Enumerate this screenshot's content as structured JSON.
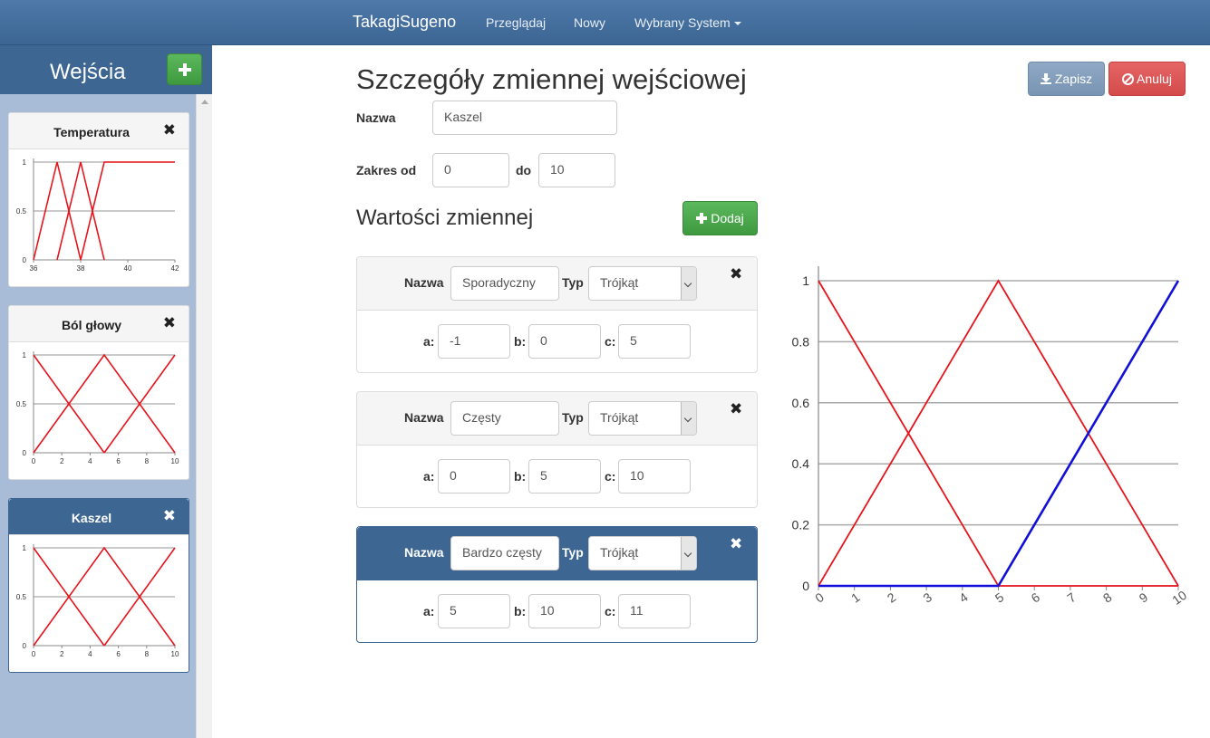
{
  "navbar": {
    "brand": "TakagiSugeno",
    "links": [
      "Przeglądaj",
      "Nowy",
      "Wybrany System"
    ]
  },
  "sidebar": {
    "title": "Wejścia",
    "cards": [
      {
        "name": "Temperatura",
        "active": false,
        "chart": {
          "xmin": 36,
          "xmax": 42,
          "xticks": [
            "36",
            "38",
            "40",
            "42"
          ],
          "yticks": [
            "1",
            "0.5",
            "0"
          ],
          "series": [
            {
              "x": [
                36,
                37,
                38
              ],
              "y": [
                0,
                1,
                0
              ]
            },
            {
              "x": [
                37,
                38,
                39
              ],
              "y": [
                0,
                1,
                0
              ]
            },
            {
              "x": [
                38,
                39,
                42
              ],
              "y": [
                0,
                1,
                1
              ]
            }
          ]
        }
      },
      {
        "name": "Ból głowy",
        "active": false,
        "chart": {
          "xmin": 0,
          "xmax": 10,
          "xticks": [
            "0",
            "2",
            "4",
            "6",
            "8",
            "10"
          ],
          "yticks": [
            "1",
            "0.5",
            "0"
          ],
          "series": [
            {
              "x": [
                0,
                5
              ],
              "y": [
                1,
                0
              ]
            },
            {
              "x": [
                0,
                5,
                10
              ],
              "y": [
                0,
                1,
                0
              ]
            },
            {
              "x": [
                5,
                10
              ],
              "y": [
                0,
                1
              ]
            }
          ]
        }
      },
      {
        "name": "Kaszel",
        "active": true,
        "chart": {
          "xmin": 0,
          "xmax": 10,
          "xticks": [
            "0",
            "2",
            "4",
            "6",
            "8",
            "10"
          ],
          "yticks": [
            "1",
            "0.5",
            "0"
          ],
          "series": [
            {
              "x": [
                0,
                5
              ],
              "y": [
                1,
                0
              ]
            },
            {
              "x": [
                0,
                5,
                10
              ],
              "y": [
                0,
                1,
                0
              ]
            },
            {
              "x": [
                5,
                10
              ],
              "y": [
                0,
                1
              ]
            }
          ]
        }
      }
    ]
  },
  "main": {
    "title": "Szczegóły zmiennej wejściowej",
    "save_label": "Zapisz",
    "cancel_label": "Anuluj",
    "name_label": "Nazwa",
    "name_value": "Kaszel",
    "range_label": "Zakres od",
    "range_from": "0",
    "range_to_label": "do",
    "range_to": "10",
    "values_title": "Wartości zmiennej",
    "add_label": "Dodaj",
    "type_label": "Typ",
    "values": [
      {
        "name": "Sporadyczny",
        "type": "Trójkąt",
        "a": "-1",
        "b": "0",
        "c": "5",
        "active": false
      },
      {
        "name": "Częsty",
        "type": "Trójkąt",
        "a": "0",
        "b": "5",
        "c": "10",
        "active": false
      },
      {
        "name": "Bardzo częsty",
        "type": "Trójkąt",
        "a": "5",
        "b": "10",
        "c": "11",
        "active": true
      }
    ]
  },
  "chart_data": {
    "type": "line",
    "title": "",
    "xlabel": "",
    "ylabel": "",
    "xlim": [
      0,
      10
    ],
    "ylim": [
      0,
      1
    ],
    "x_ticks": [
      "0",
      "1",
      "2",
      "3",
      "4",
      "5",
      "6",
      "7",
      "8",
      "9",
      "10"
    ],
    "y_ticks": [
      "0",
      "0.2",
      "0.4",
      "0.6",
      "0.8",
      "1"
    ],
    "grid": true,
    "series": [
      {
        "color": "#e8141c",
        "x": [
          0,
          5,
          10
        ],
        "y": [
          1,
          0,
          0
        ]
      },
      {
        "color": "#e8141c",
        "x": [
          0,
          5,
          10
        ],
        "y": [
          0,
          1,
          0
        ]
      },
      {
        "color": "#1010d8",
        "x": [
          0,
          5,
          10
        ],
        "y": [
          0,
          0,
          1
        ]
      }
    ]
  }
}
